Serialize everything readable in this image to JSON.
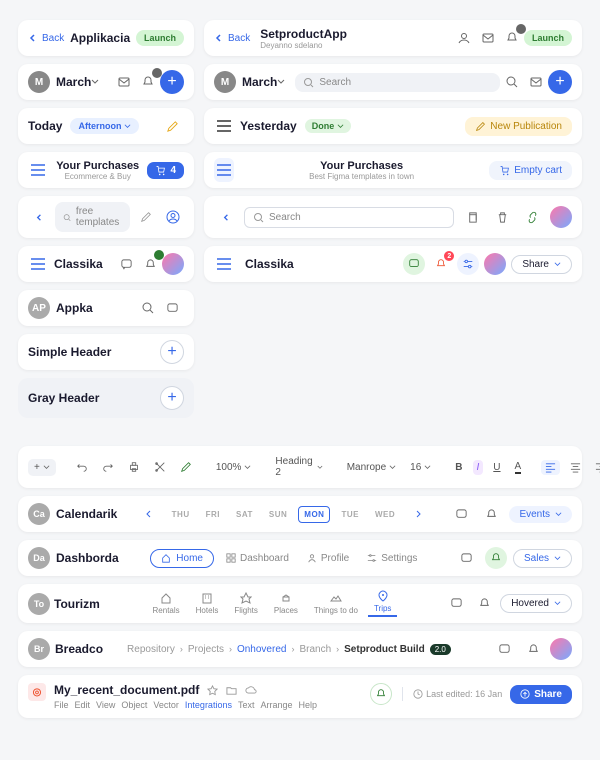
{
  "r1": {
    "back": "Back",
    "title": "Applikacia",
    "launch": "Launch",
    "app_title": "SetproductApp",
    "app_sub": "Deyanno sdelano"
  },
  "r2": {
    "avatar": "M",
    "title": "March",
    "search": "Search"
  },
  "r3": {
    "today": "Today",
    "afternoon": "Afternoon",
    "yesterday": "Yesterday",
    "done": "Done",
    "newpub": "New Publication"
  },
  "r4": {
    "title": "Your Purchases",
    "sub1": "Ecommerce & Buy",
    "cart": "4",
    "sub2": "Best Figma templates in town",
    "empty": "Empty cart"
  },
  "r5": {
    "search1": "free templates",
    "search2": "Search"
  },
  "r6": {
    "title": "Classika",
    "share": "Share",
    "notif": "2"
  },
  "r7": {
    "avatar": "AP",
    "title": "Appka"
  },
  "r8": {
    "title": "Simple Header"
  },
  "r9": {
    "title": "Gray Header"
  },
  "toolbar": {
    "zoom": "100%",
    "heading": "Heading 2",
    "font": "Manrope",
    "size": "16"
  },
  "cal": {
    "avatar": "Ca",
    "title": "Calendarik",
    "days": [
      "THU",
      "FRI",
      "SAT",
      "SUN",
      "MON",
      "TUE",
      "WED"
    ],
    "events": "Events"
  },
  "dash": {
    "avatar": "Da",
    "title": "Dashborda",
    "home": "Home",
    "dashboard": "Dashboard",
    "profile": "Profile",
    "settings": "Settings",
    "sales": "Sales"
  },
  "tour": {
    "avatar": "To",
    "title": "Tourizm",
    "items": [
      "Rentals",
      "Hotels",
      "Flights",
      "Places",
      "Things to do",
      "Trips"
    ],
    "hovered": "Hovered"
  },
  "bread": {
    "avatar": "Br",
    "title": "Breadco",
    "crumbs": [
      "Repository",
      "Projects",
      "Onhovered",
      "Branch",
      "Setproduct Build"
    ],
    "ver": "2.0"
  },
  "doc": {
    "title": "My_recent_document.pdf",
    "menu": [
      "File",
      "Edit",
      "View",
      "Object",
      "Vector",
      "Integrations",
      "Text",
      "Arrange",
      "Help"
    ],
    "edited": "Last edited: 16 Jan",
    "share": "Share"
  }
}
